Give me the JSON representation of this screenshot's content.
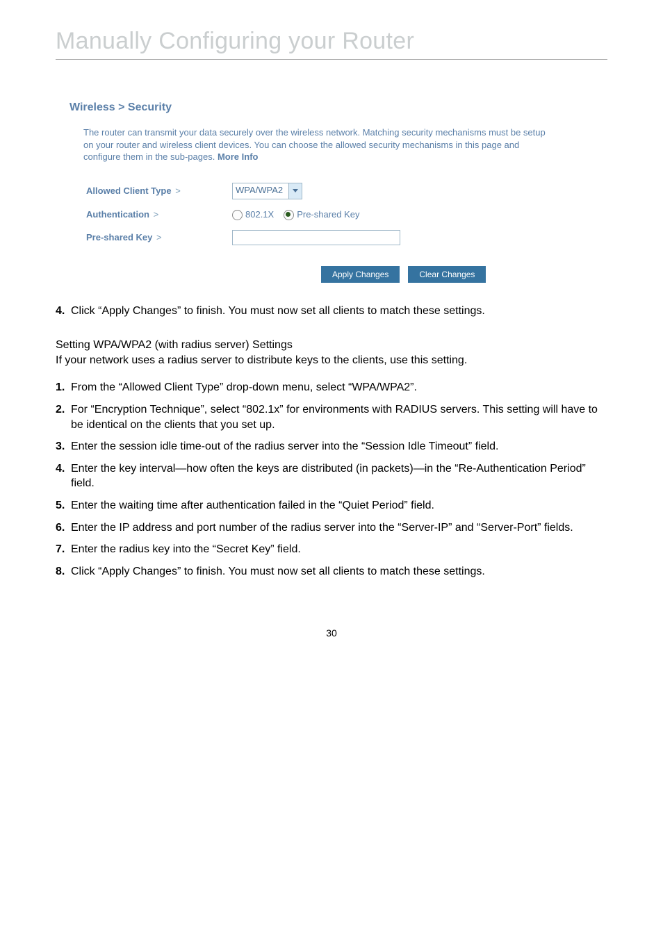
{
  "header": {
    "title": "Manually Configuring your Router"
  },
  "panel": {
    "heading": "Wireless > Security",
    "description": "The router can transmit your data securely over the wireless network. Matching security mechanisms must be setup on your router and wireless client devices. You can choose the allowed security mechanisms in this page and configure them in the sub-pages.",
    "more_info": "More Info",
    "labels": {
      "client_type": "Allowed Client Type",
      "authentication": "Authentication",
      "psk": "Pre-shared Key"
    },
    "chevron": ">",
    "select_value": "WPA/WPA2",
    "radio1": "802.1X",
    "radio2": "Pre-shared Key",
    "buttons": {
      "apply": "Apply Changes",
      "clear": "Clear Changes"
    }
  },
  "step4": {
    "num": "4.",
    "text": "Click “Apply Changes” to finish. You must now set all clients to match these settings."
  },
  "radius": {
    "title": "Setting WPA/WPA2 (with radius server) Settings",
    "intro": "If your network uses a radius server to distribute keys to the clients, use this setting."
  },
  "steps": {
    "s1n": "1.",
    "s1": "From the “Allowed Client Type” drop-down menu, select “WPA/WPA2”.",
    "s2n": "2.",
    "s2": "For “Encryption Technique”, select “802.1x” for environments with RADIUS servers. This setting will have to be identical on the clients that you set up.",
    "s3n": "3.",
    "s3": "Enter the session idle time-out of the radius server into the “Session Idle Timeout” field.",
    "s4n": "4.",
    "s4": "Enter the key interval—how often the keys are distributed (in packets)—in the “Re-Authentication Period” field.",
    "s5n": "5.",
    "s5": "Enter the waiting time after authentication failed in the “Quiet Period” field.",
    "s6n": "6.",
    "s6": "Enter the IP address and port number of the radius server into the “Server-IP” and “Server-Port” fields.",
    "s7n": "7.",
    "s7": "Enter the radius key into the “Secret Key” field.",
    "s8n": "8.",
    "s8": "Click “Apply Changes” to finish. You must now set all clients to match these settings."
  },
  "pagenum": "30"
}
